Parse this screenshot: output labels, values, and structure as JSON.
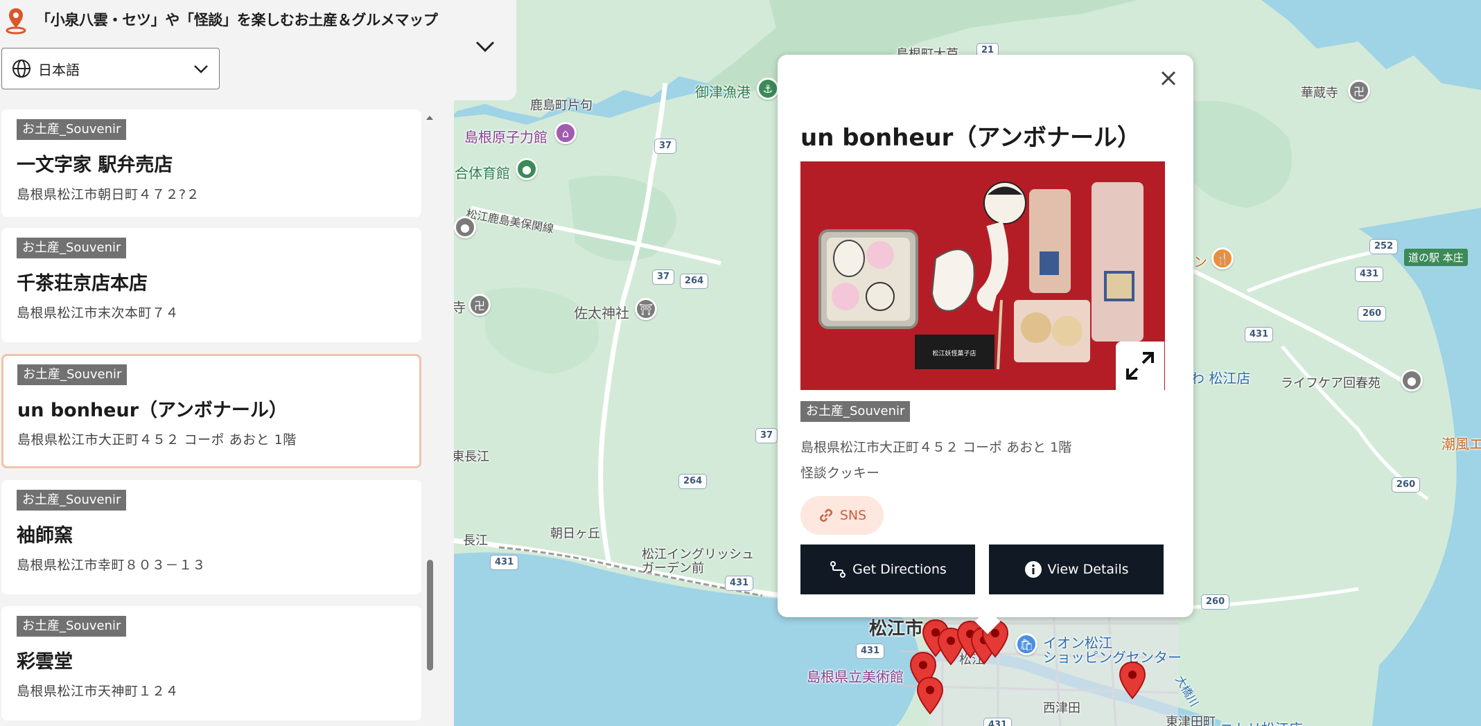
{
  "app": {
    "title": "「小泉八雲・セツ」や「怪談」を楽しむお土産＆グルメマップ",
    "language": "日本語"
  },
  "list": [
    {
      "tag": "お土産_Souvenir",
      "name": "一文字家 駅弁売店",
      "address": "島根県松江市朝日町４７２?２"
    },
    {
      "tag": "お土産_Souvenir",
      "name": "千茶荘京店本店",
      "address": "島根県松江市末次本町７４"
    },
    {
      "tag": "お土産_Souvenir",
      "name": "un bonheur（アンボナール）",
      "address": "島根県松江市大正町４５２ コーポ あおと 1階",
      "selected": true
    },
    {
      "tag": "お土産_Souvenir",
      "name": "袖師窯",
      "address": "島根県松江市幸町８０３－１３"
    },
    {
      "tag": "お土産_Souvenir",
      "name": "彩雲堂",
      "address": "島根県松江市天神町１２４"
    }
  ],
  "popup": {
    "title": "un bonheur（アンボナール）",
    "tag": "お土産_Souvenir",
    "address": "島根県松江市大正町４５２ コーポ あおと 1階",
    "description": "怪談クッキー",
    "sns_label": "SNS",
    "directions_label": "Get Directions",
    "details_label": "View Details",
    "photo_box_label": "松江妖怪菓子店"
  },
  "map": {
    "labels": {
      "shimane_town": "島根町大芦",
      "mitsu_port": "御津漁港",
      "kashima_town": "鹿島町片句",
      "nuclear_hall": "島根原子力館",
      "gym": "合体育館",
      "railway": "松江鹿島美保関線",
      "sadajinja": "佐太神社",
      "tera": "寺",
      "higashi_nagae": "東長江",
      "nagae": "長江",
      "asahigaoka": "朝日ヶ丘",
      "english_garden_1": "松江イングリッシュ",
      "english_garden_2": "ガーデン前",
      "matsue_city": "松江市",
      "museum": "島根県立美術館",
      "matsue_station": "松江",
      "aeon_1": "イオン松江",
      "aeon_2": "ショッピングセンター",
      "nishitsuda": "西津田",
      "higashitsuda": "東津田町",
      "nitori": "ニトリ松江店",
      "kezoji": "華蔵寺",
      "michinoeki": "道の駅 本庄",
      "lifecare": "ライフケア回春苑",
      "wa_matsue": "わ 松江店",
      "chofu": "潮風エ",
      "ohashi": "大橋川",
      "ten": "ン"
    },
    "routes": [
      "21",
      "37",
      "37",
      "264",
      "37",
      "264",
      "431",
      "431",
      "431",
      "431",
      "252",
      "431",
      "260",
      "260",
      "260",
      "431"
    ]
  }
}
